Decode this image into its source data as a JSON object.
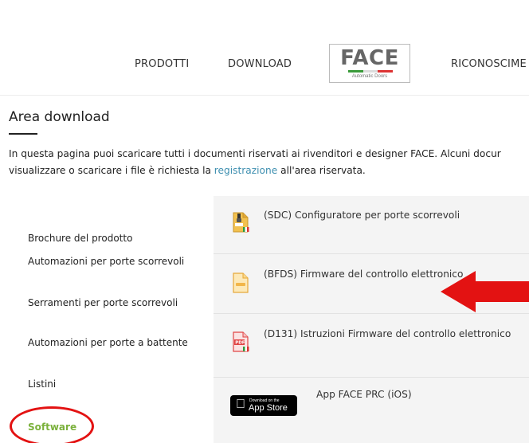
{
  "nav": {
    "prodotti": "PRODOTTI",
    "download": "DOWNLOAD",
    "riconoscimenti": "RICONOSCIME",
    "logo_text": "FACE",
    "logo_sub": "Automatic Doors"
  },
  "page": {
    "title": "Area download",
    "intro_line1": "In questa pagina puoi scaricare tutti i documenti riservati ai rivenditori e designer FACE. Alcuni docur",
    "intro_line2_before": "visualizzare o scaricare i file è richiesta la ",
    "intro_link": "registrazione",
    "intro_line2_after": " all'area riservata."
  },
  "sidebar": {
    "items": [
      {
        "label": "Brochure del prodotto"
      },
      {
        "label": "Automazioni per porte scorrevoli"
      },
      {
        "label": "Serramenti per porte scorrevoli"
      },
      {
        "label": "Automazioni per porte a battente"
      },
      {
        "label": "Listini"
      },
      {
        "label": "Software",
        "active": true
      }
    ]
  },
  "downloads": [
    {
      "label": "(SDC) Configuratore per porte scorrevoli",
      "icon": "zip-file-icon"
    },
    {
      "label": "(BFDS) Firmware del controllo elettronico",
      "icon": "archive-file-icon"
    },
    {
      "label": "(D131) Istruzioni Firmware del controllo elettronico",
      "icon": "pdf-file-icon"
    },
    {
      "label": "App FACE PRC (iOS)",
      "icon": "app-store-badge"
    }
  ],
  "appstore": {
    "small": "Download on the",
    "big": "App Store"
  },
  "colors": {
    "accent_green": "#7bb13c",
    "link_blue": "#3e8fb0",
    "annotation_red": "#e31212"
  }
}
